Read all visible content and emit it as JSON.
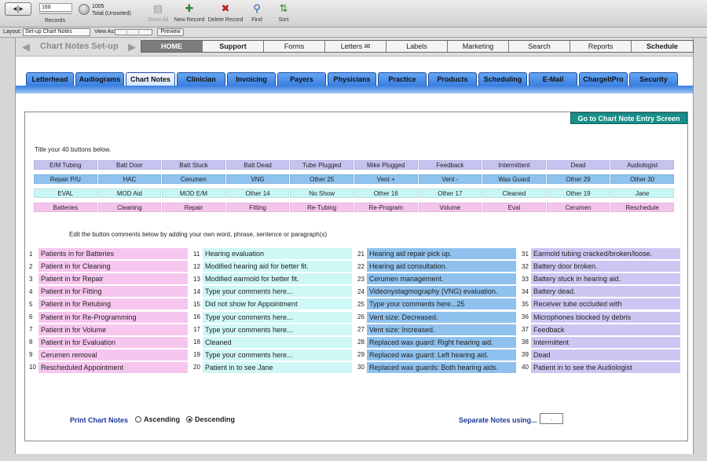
{
  "toolbar": {
    "record_number": "168",
    "records_label": "Records",
    "total_count": "1005",
    "total_label": "Total (Unsorted)",
    "buttons": [
      {
        "label": "Show All",
        "icon": "show-all-icon"
      },
      {
        "label": "New Record",
        "icon": "new-record-icon"
      },
      {
        "label": "Delete Record",
        "icon": "delete-record-icon"
      },
      {
        "label": "Find",
        "icon": "find-icon"
      },
      {
        "label": "Sort",
        "icon": "sort-icon"
      }
    ]
  },
  "layoutbar": {
    "layout_label": "Layout:",
    "layout_value": "Set-up Chart Notes",
    "view_as_label": "View As:",
    "preview_label": "Preview"
  },
  "header": {
    "title": "Chart Notes Set-up",
    "nav": [
      "HOME",
      "Support",
      "Forms",
      "Letters",
      "Labels",
      "Marketing",
      "Search",
      "Reports",
      "Schedule"
    ]
  },
  "tabs": [
    "Letterhead",
    "Audiograms",
    "Chart Notes",
    "Clinician",
    "Invoicing",
    "Payers",
    "Physicians",
    "Practice",
    "Products",
    "Scheduling",
    "E-Mail",
    "ChargeItPro",
    "Security"
  ],
  "active_tab": "Chart Notes",
  "goto_label": "Go to Chart Note Entry Screen",
  "title_instruction": "Title your 40 buttons below.",
  "button_rows": [
    [
      "E/M Tubing",
      "Batt Door",
      "Batt Stuck",
      "Batt Dead",
      "Tube Plugged",
      "Mike Plugged",
      "Feedback",
      "Intermittent",
      "Dead",
      "Audiologist"
    ],
    [
      "Repair P/U",
      "HAC",
      "Cerumen",
      "VNG",
      "Other 25",
      "Vent +",
      "Vent -",
      "Wax Guard",
      "Other 29",
      "Other 30"
    ],
    [
      "EVAL",
      "MOD Aid",
      "MOD E/M",
      "Other 14",
      "No Show",
      "Other 16",
      "Other 17",
      "Cleaned",
      "Other 19",
      "Jane"
    ],
    [
      "Batteries",
      "Cleaning",
      "Repair",
      "Fitting",
      "Re-Tubing",
      "Re-Program",
      "Volume",
      "Eval",
      "Cerumen",
      "Reschedule"
    ]
  ],
  "edit_instruction": "Edit the button comments below by adding your own word, phrase, sentence or paragraph(s)",
  "comment_columns": [
    [
      {
        "num": "1",
        "text": "Patients in for Batteries"
      },
      {
        "num": "2",
        "text": "Patient in for Cleaning"
      },
      {
        "num": "3",
        "text": "Patient in for Repair"
      },
      {
        "num": "4",
        "text": "Patient in for Fitting"
      },
      {
        "num": "5",
        "text": "Patient in for Retubing"
      },
      {
        "num": "6",
        "text": "Patient in for Re-Programming"
      },
      {
        "num": "7",
        "text": "Patient in for Volume"
      },
      {
        "num": "8",
        "text": "Patient in for Evaluation"
      },
      {
        "num": "9",
        "text": "Cerumen removal"
      },
      {
        "num": "10",
        "text": "Rescheduled Appointment"
      }
    ],
    [
      {
        "num": "11",
        "text": "Hearing evaluation"
      },
      {
        "num": "12",
        "text": "Modified hearing aid for better fit."
      },
      {
        "num": "13",
        "text": "Modified earmold for better fit."
      },
      {
        "num": "14",
        "text": "Type your comments here..."
      },
      {
        "num": "15",
        "text": "Did not show for Appointment"
      },
      {
        "num": "16",
        "text": "Type your comments here..."
      },
      {
        "num": "17",
        "text": "Type your comments here..."
      },
      {
        "num": "18",
        "text": "Cleaned"
      },
      {
        "num": "19",
        "text": "Type your comments here..."
      },
      {
        "num": "20",
        "text": "Patient in to see Jane"
      }
    ],
    [
      {
        "num": "21",
        "text": "Hearing aid repair pick up."
      },
      {
        "num": "22",
        "text": "Hearing aid consultation."
      },
      {
        "num": "23",
        "text": "Cerumen management."
      },
      {
        "num": "24",
        "text": "Videonystagmography (VNG) evaluation."
      },
      {
        "num": "25",
        "text": "Type your comments here...25"
      },
      {
        "num": "26",
        "text": "Vent size: Decreased."
      },
      {
        "num": "27",
        "text": "Vent size: Increased."
      },
      {
        "num": "28",
        "text": "Replaced wax guard: Right hearing aid."
      },
      {
        "num": "29",
        "text": "Replaced wax guard: Left hearing aid."
      },
      {
        "num": "30",
        "text": "Replaced wax guards: Both hearing aids."
      }
    ],
    [
      {
        "num": "31",
        "text": "Earmold tubing cracked/broken/loose."
      },
      {
        "num": "32",
        "text": "Battery door broken."
      },
      {
        "num": "33",
        "text": "Battery stuck in hearing aid."
      },
      {
        "num": "34",
        "text": "Battery dead."
      },
      {
        "num": "35",
        "text": "Receiver tube occluded with"
      },
      {
        "num": "36",
        "text": "Microphones blocked by debris"
      },
      {
        "num": "37",
        "text": "Feedback"
      },
      {
        "num": "38",
        "text": "Intermittent"
      },
      {
        "num": "39",
        "text": "Dead"
      },
      {
        "num": "40",
        "text": "Patient in to see the Audiologist"
      }
    ]
  ],
  "print": {
    "label": "Print Chart  Notes",
    "ascending": "Ascending",
    "descending": "Descending",
    "selected": "Descending"
  },
  "separate": {
    "label": "Separate Notes using...",
    "value": "."
  }
}
